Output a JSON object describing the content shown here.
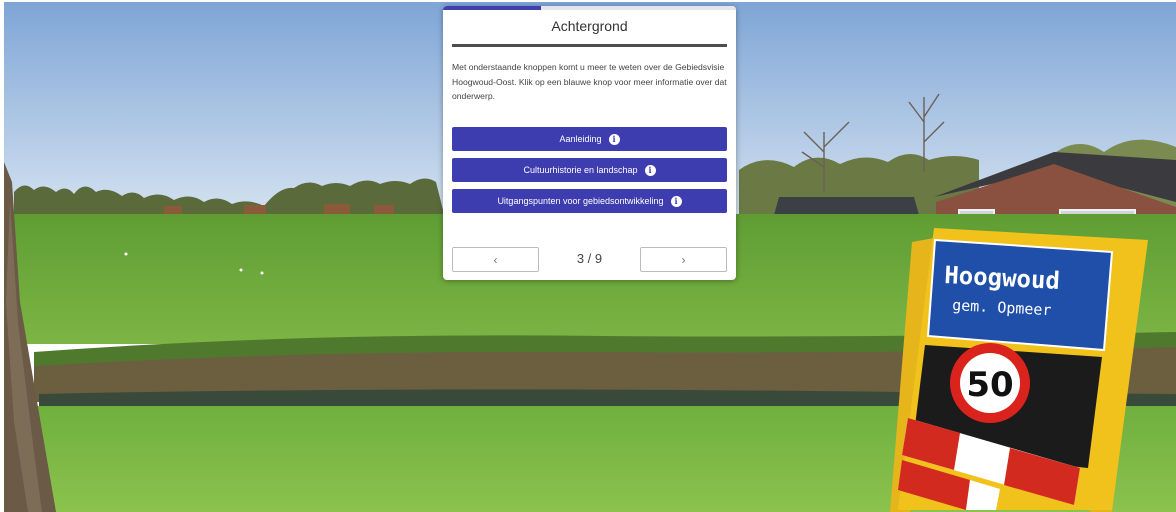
{
  "panel": {
    "title": "Achtergrond",
    "progress_fraction": 0.3333,
    "intro": "Met onderstaande knoppen komt u meer te weten over de Gebiedsvisie Hoogwoud-Oost. Klik op een blauwe knop voor meer informatie over dat onderwerp.",
    "buttons": [
      {
        "label": "Aanleiding"
      },
      {
        "label": "Cultuurhistorie en landschap"
      },
      {
        "label": "Uitgangspunten voor gebiedsontwikkeling"
      }
    ],
    "info_icon_glyph": "i",
    "prev_glyph": "‹",
    "next_glyph": "›",
    "page_indicator": "3 / 9"
  },
  "sign": {
    "place": "Hoogwoud",
    "municipality": "gem. Opmeer",
    "speed_limit": "50"
  },
  "colors": {
    "accent": "#3d3db0",
    "sky": "#a9c7e6",
    "grass": "#6aa83c",
    "sign_blue": "#1f4fa8",
    "sign_yellow": "#f1c21b",
    "speed_red": "#d9231c"
  }
}
